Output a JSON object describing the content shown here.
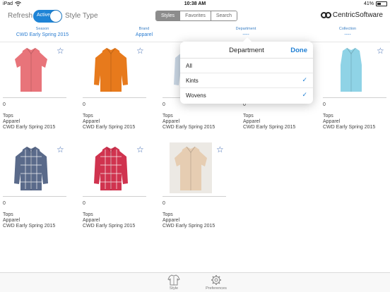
{
  "status_bar": {
    "carrier": "iPad",
    "time": "10:38 AM",
    "battery": "41%",
    "battery_level": 0.41
  },
  "toolbar": {
    "refresh_label": "Refresh",
    "toggle_label": "Active",
    "toggle_on": true,
    "style_type_label": "Style Type",
    "segments": [
      "Styles",
      "Favorites",
      "Search"
    ],
    "active_segment": "Styles",
    "logo_text": "CentricSoftware"
  },
  "filters": [
    {
      "label": "Season",
      "value": "CWD Early Spring 2015"
    },
    {
      "label": "Brand",
      "value": "Apparel"
    },
    {
      "label": "Department",
      "value": "----"
    },
    {
      "label": "Collection",
      "value": "----"
    }
  ],
  "products": [
    {
      "count": "0",
      "category": "Tops",
      "brand": "Apparel",
      "season": "CWD Early Spring 2015",
      "color": "#e8747a",
      "pattern": "solid",
      "sleeves": "short"
    },
    {
      "count": "0",
      "category": "Tops",
      "brand": "Apparel",
      "season": "CWD Early Spring 2015",
      "color": "#e77a1c",
      "pattern": "solid",
      "sleeves": "long"
    },
    {
      "count": "0",
      "category": "Tops",
      "brand": "Apparel",
      "season": "CWD Early Spring 2015",
      "color": "#c9d6e3",
      "pattern": "solid",
      "sleeves": "long"
    },
    {
      "count": "0",
      "category": "Tops",
      "brand": "Apparel",
      "season": "CWD Early Spring 2015",
      "color": "#e0dcd5",
      "pattern": "solid",
      "sleeves": "short"
    },
    {
      "count": "0",
      "category": "Tops",
      "brand": "Apparel",
      "season": "CWD Early Spring 2015",
      "color": "#8fd3e6",
      "pattern": "solid",
      "sleeves": "none"
    },
    {
      "count": "0",
      "category": "Tops",
      "brand": "Apparel",
      "season": "CWD Early Spring 2015",
      "color": "#5a6a8a",
      "pattern": "plaid",
      "sleeves": "long"
    },
    {
      "count": "0",
      "category": "Tops",
      "brand": "Apparel",
      "season": "CWD Early Spring 2015",
      "color": "#d0334f",
      "pattern": "plaid",
      "sleeves": "long"
    },
    {
      "count": "0",
      "category": "Tops",
      "brand": "Apparel",
      "season": "CWD Early Spring 2015",
      "color": "#e6cdb2",
      "pattern": "solid",
      "sleeves": "short"
    }
  ],
  "popover": {
    "title": "Department",
    "done_label": "Done",
    "options": [
      {
        "label": "All",
        "checked": false
      },
      {
        "label": "Kints",
        "checked": true
      },
      {
        "label": "Wovens",
        "checked": true
      }
    ],
    "check_glyph": "✓"
  },
  "tabbar": {
    "tabs": [
      {
        "label": "Style",
        "icon": "shirt-icon"
      },
      {
        "label": "Preferences",
        "icon": "gear-icon"
      }
    ]
  },
  "colors": {
    "accent": "#1f84d6",
    "star": "#3b67b0"
  }
}
